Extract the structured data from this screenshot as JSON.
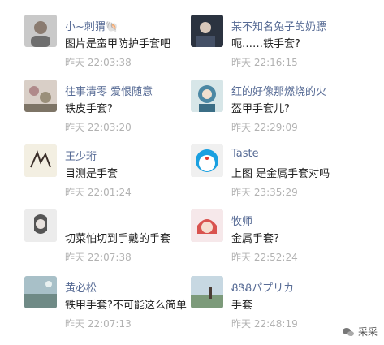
{
  "comments": [
    {
      "name": "小~刺猬🐚",
      "text": "图片是蛮甲防护手套吧",
      "time": "昨天 22:03:38",
      "avatar": "girl-avatar"
    },
    {
      "name": "某不知名兔子的奶膘",
      "text": "呃……铁手套?",
      "time": "昨天 22:16:15",
      "avatar": "illustration-avatar"
    },
    {
      "name": "往事清零 爱恨随意",
      "text": "铁皮手套?",
      "time": "昨天 22:03:20",
      "avatar": "floral-avatar"
    },
    {
      "name": "红的好像那燃烧的火",
      "text": "盔甲手套儿?",
      "time": "昨天 22:29:09",
      "avatar": "cartoon-avatar"
    },
    {
      "name": "王少珩",
      "text": "目测是手套",
      "time": "昨天 22:01:24",
      "avatar": "calligraphy-avatar"
    },
    {
      "name": "Taste",
      "text": "上图 是金属手套对吗",
      "time": "昨天 23:35:29",
      "avatar": "doraemon-avatar"
    },
    {
      "name": "",
      "text": "切菜怕切到手戴的手套",
      "time": "昨天 22:07:38",
      "avatar": "sketch-girl-avatar"
    },
    {
      "name": "牧师",
      "text": "金属手套?",
      "time": "昨天 22:52:24",
      "avatar": "redhead-avatar"
    },
    {
      "name": "黄必松",
      "text": "铁甲手套?不可能这么简单",
      "time": "昨天 22:07:13",
      "avatar": "landscape-avatar"
    },
    {
      "name": "ᏰᏕᏰパプリカ",
      "text": "手套",
      "time": "昨天 22:48:19",
      "avatar": "scenery-avatar"
    }
  ],
  "watermark": {
    "text": "采采"
  }
}
